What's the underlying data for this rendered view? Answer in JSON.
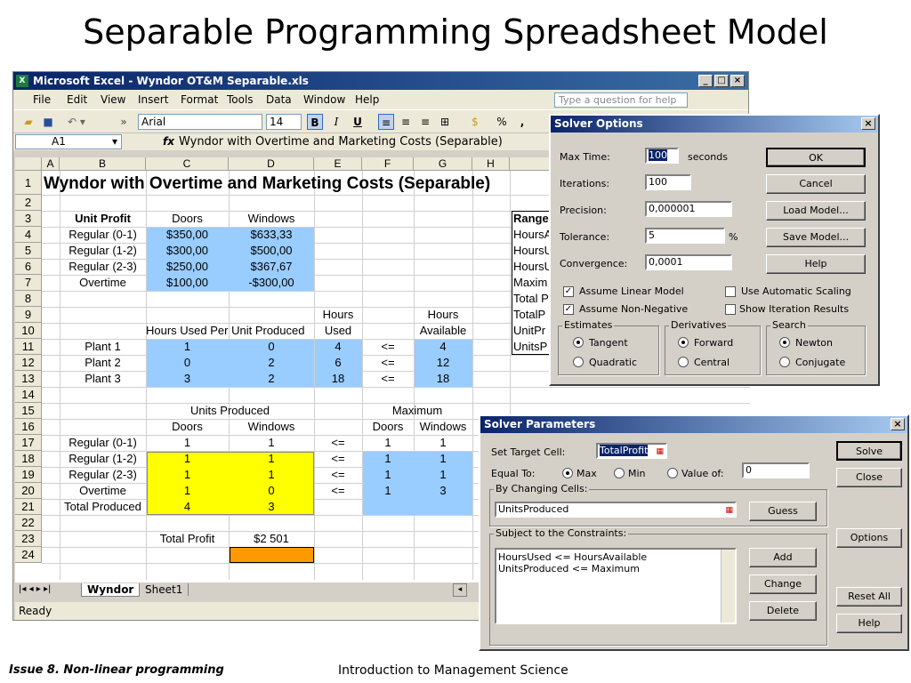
{
  "slide": {
    "title": "Separable Programming Spreadsheet Model",
    "footer_left": "Issue 8. Non-linear programming",
    "footer_center": "Introduction to Management Science"
  },
  "excel": {
    "window_title": "Microsoft Excel - Wyndor OT&M Separable.xls",
    "window_icon": "excel-app-icon",
    "menu": [
      "File",
      "Edit",
      "View",
      "Insert",
      "Format",
      "Tools",
      "Data",
      "Window",
      "Help"
    ],
    "help_placeholder": "Type a question for help",
    "font_name": "Arial",
    "font_size": "14",
    "bold": "B",
    "italic": "I",
    "underline": "U",
    "percent": "%",
    "comma": ",",
    "name_box": "A1",
    "fx": "fx",
    "formula": "Wyndor with Overtime and Marketing Costs (Separable)",
    "columns": [
      "A",
      "B",
      "C",
      "D",
      "E",
      "F",
      "G",
      "H"
    ],
    "rows": [
      "1",
      "2",
      "3",
      "4",
      "5",
      "6",
      "7",
      "8",
      "9",
      "10",
      "11",
      "12",
      "13",
      "14",
      "15",
      "16",
      "17",
      "18",
      "19",
      "20",
      "21",
      "22",
      "23",
      "24"
    ],
    "sheet_tabs": [
      "Wyndor",
      "Sheet1"
    ],
    "status": "Ready",
    "cells": {
      "title": "Wyndor with Overtime and Marketing Costs (Separable)",
      "unit_profit": "Unit Profit",
      "doors": "Doors",
      "windows": "Windows",
      "profit_rows": [
        {
          "label": "Regular (0-1)",
          "doors": "$350,00",
          "windows": "$633,33"
        },
        {
          "label": "Regular (1-2)",
          "doors": "$300,00",
          "windows": "$500,00"
        },
        {
          "label": "Regular (2-3)",
          "doors": "$250,00",
          "windows": "$367,67"
        },
        {
          "label": "Overtime",
          "doors": "$100,00",
          "windows": "-$300,00"
        }
      ],
      "hours": "Hours",
      "used": "Used",
      "available": "Available",
      "hours_per_unit": "Hours Used Per Unit Produced",
      "plant_rows": [
        {
          "label": "Plant 1",
          "doors": "1",
          "windows": "0",
          "used": "4",
          "op": "<=",
          "available": "4"
        },
        {
          "label": "Plant 2",
          "doors": "0",
          "windows": "2",
          "used": "6",
          "op": "<=",
          "available": "12"
        },
        {
          "label": "Plant 3",
          "doors": "3",
          "windows": "2",
          "used": "18",
          "op": "<=",
          "available": "18"
        }
      ],
      "units_produced": "Units Produced",
      "maximum": "Maximum",
      "unit_rows": [
        {
          "label": "Regular (0-1)",
          "doors": "1",
          "windows": "1",
          "op": "<=",
          "max_doors": "1",
          "max_windows": "1"
        },
        {
          "label": "Regular (1-2)",
          "doors": "1",
          "windows": "1",
          "op": "<=",
          "max_doors": "1",
          "max_windows": "1"
        },
        {
          "label": "Regular (2-3)",
          "doors": "1",
          "windows": "1",
          "op": "<=",
          "max_doors": "1",
          "max_windows": "1"
        },
        {
          "label": "Overtime",
          "doors": "1",
          "windows": "0",
          "op": "<=",
          "max_doors": "1",
          "max_windows": "3"
        }
      ],
      "total_produced": "Total Produced",
      "total_doors": "4",
      "total_windows": "3",
      "total_profit": "Total Profit",
      "total_profit_value": "$2 501",
      "range_names": [
        "Range",
        "HoursA",
        "HoursU",
        "HoursU",
        "Maxim",
        "Total P",
        "TotalP",
        "UnitPr",
        "UnitsP"
      ]
    }
  },
  "solver_options": {
    "title": "Solver Options",
    "max_time_label": "Max Time:",
    "max_time": "100",
    "seconds": "seconds",
    "iterations_label": "Iterations:",
    "iterations": "100",
    "precision_label": "Precision:",
    "precision": "0,000001",
    "tolerance_label": "Tolerance:",
    "tolerance": "5",
    "percent": "%",
    "convergence_label": "Convergence:",
    "convergence": "0,0001",
    "ok": "OK",
    "cancel": "Cancel",
    "load_model": "Load Model...",
    "save_model": "Save Model...",
    "help": "Help",
    "assume_linear": "Assume Linear Model",
    "use_auto_scaling": "Use Automatic Scaling",
    "assume_non_negative": "Assume Non-Negative",
    "show_iteration": "Show Iteration Results",
    "estimates": "Estimates",
    "tangent": "Tangent",
    "quadratic": "Quadratic",
    "derivatives": "Derivatives",
    "forward": "Forward",
    "central": "Central",
    "search": "Search",
    "newton": "Newton",
    "conjugate": "Conjugate"
  },
  "solver_params": {
    "title": "Solver Parameters",
    "set_target_label": "Set Target Cell:",
    "target": "TotalProfit",
    "equal_to": "Equal To:",
    "max": "Max",
    "min": "Min",
    "value_of": "Value of:",
    "value": "0",
    "changing_cells_label": "By Changing Cells:",
    "changing_cells": "UnitsProduced",
    "guess": "Guess",
    "constraints_label": "Subject to the Constraints:",
    "constraints": [
      "HoursUsed <= HoursAvailable",
      "UnitsProduced <= Maximum"
    ],
    "add": "Add",
    "change": "Change",
    "delete": "Delete",
    "solve": "Solve",
    "close": "Close",
    "options": "Options",
    "reset_all": "Reset All",
    "help": "Help"
  }
}
